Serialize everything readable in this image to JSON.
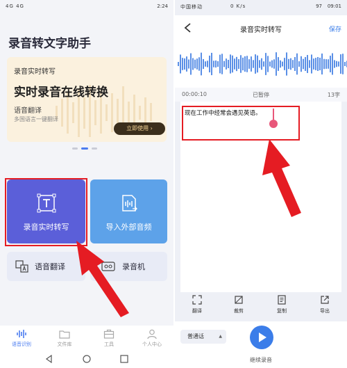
{
  "left": {
    "status": {
      "signal": "4G 4G",
      "time": "2:24"
    },
    "app_title": "录音转文字助手",
    "banner": {
      "kicker": "录音实时转写",
      "headline": "实时录音在线转换",
      "sub": "语音翻译",
      "sub_desc": "多国语言一键翻译",
      "button": "立即使用"
    },
    "cards": {
      "transcribe": "录音实时转写",
      "import_audio": "导入外部音频",
      "translate": "语音翻译",
      "recorder": "录音机"
    },
    "tabs": [
      "语音识别",
      "文件库",
      "工具",
      "个人中心"
    ]
  },
  "right": {
    "status": {
      "carrier": "中国移动",
      "speed": "0 K/s",
      "battery": "97",
      "time": "09:01"
    },
    "title": "录音实时转写",
    "save": "保存",
    "info": {
      "elapsed": "00:00:10",
      "state": "已暂停",
      "count": "13字"
    },
    "transcript": "现在工作中经常会遇见英语。",
    "tools": [
      "翻译",
      "裁剪",
      "复制",
      "导出"
    ],
    "language": "普通话",
    "continue": "继续录音"
  },
  "colors": {
    "accent_blue": "#3b7de9",
    "transcribe_card": "#5b5fd9",
    "import_card": "#5da2e9",
    "annotation_red": "#e51c23"
  }
}
